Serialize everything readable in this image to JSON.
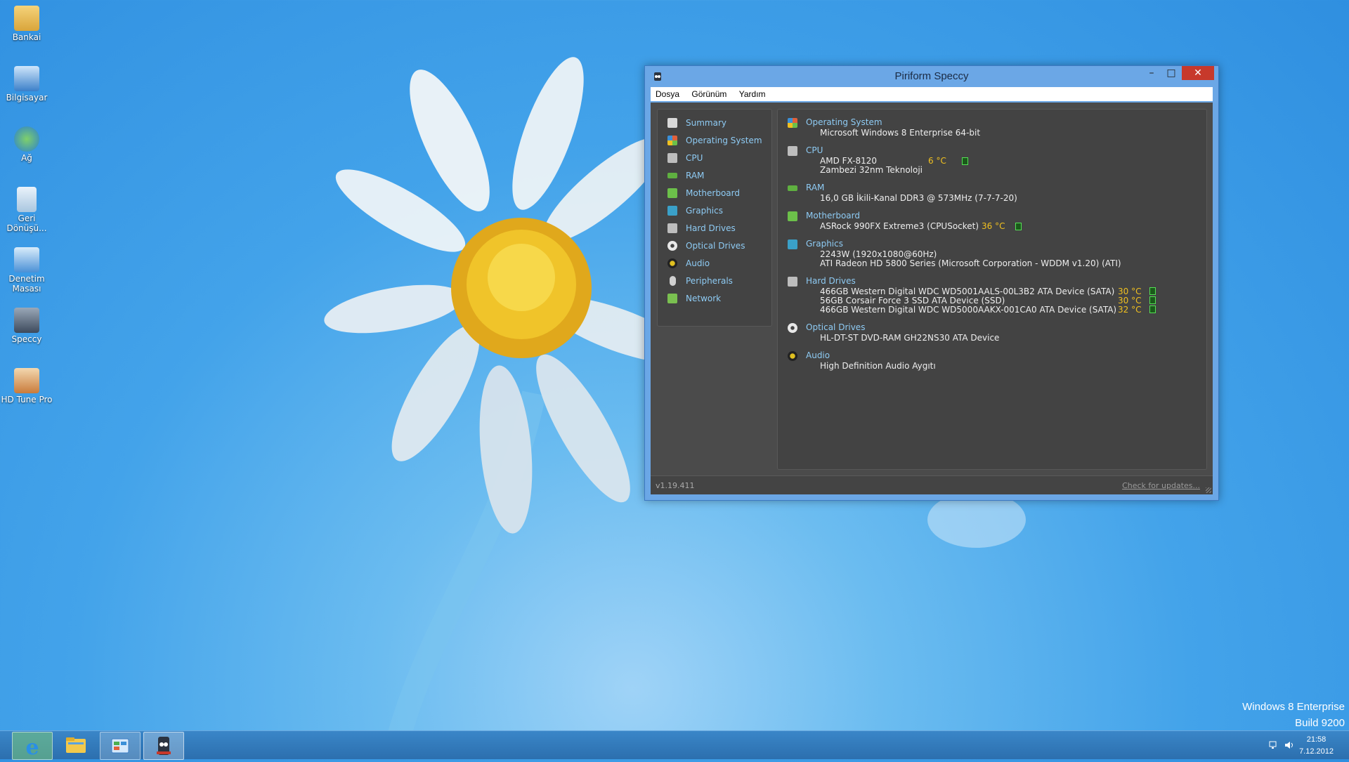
{
  "desktop": {
    "icons": [
      {
        "label": "Bankai",
        "icon": "folder-icon"
      },
      {
        "label": "Bilgisayar",
        "icon": "computer-icon"
      },
      {
        "label": "Ağ",
        "icon": "network-icon"
      },
      {
        "label": "Geri Dönüşü...",
        "icon": "recycle-bin-icon"
      },
      {
        "label": "Denetim Masası",
        "icon": "control-panel-icon"
      },
      {
        "label": "Speccy",
        "icon": "speccy-icon"
      },
      {
        "label": "HD Tune Pro",
        "icon": "hd-tune-icon"
      }
    ],
    "watermark": {
      "line1": "Windows 8 Enterprise",
      "line2": "Build 9200"
    }
  },
  "window": {
    "title": "Piriform Speccy",
    "controls": {
      "minimize": "–",
      "maximize": "□",
      "close": "✕"
    },
    "menu": [
      "Dosya",
      "Görünüm",
      "Yardım"
    ],
    "sidebar": [
      {
        "label": "Summary",
        "icon": "summary-icon",
        "color": "#d8d8d8"
      },
      {
        "label": "Operating System",
        "icon": "windows-icon",
        "color": "#e0603a"
      },
      {
        "label": "CPU",
        "icon": "cpu-icon",
        "color": "#bdbdbd"
      },
      {
        "label": "RAM",
        "icon": "ram-icon",
        "color": "#5fb040"
      },
      {
        "label": "Motherboard",
        "icon": "motherboard-icon",
        "color": "#6cc04a"
      },
      {
        "label": "Graphics",
        "icon": "graphics-icon",
        "color": "#3aa0c8"
      },
      {
        "label": "Hard Drives",
        "icon": "hard-drive-icon",
        "color": "#bdbdbd"
      },
      {
        "label": "Optical Drives",
        "icon": "optical-drive-icon",
        "color": "#e8e8e8"
      },
      {
        "label": "Audio",
        "icon": "audio-icon",
        "color": "#e0c020"
      },
      {
        "label": "Peripherals",
        "icon": "peripherals-icon",
        "color": "#d0d0d0"
      },
      {
        "label": "Network",
        "icon": "network-icon",
        "color": "#7ac050"
      }
    ],
    "summary": {
      "os": {
        "title": "Operating System",
        "value": "Microsoft Windows 8 Enterprise 64-bit"
      },
      "cpu": {
        "title": "CPU",
        "model": "AMD FX-8120",
        "temp": "6 °C",
        "detail": "Zambezi 32nm Teknoloji"
      },
      "ram": {
        "title": "RAM",
        "value": "16,0 GB İkili-Kanal DDR3 @ 573MHz (7-7-7-20)"
      },
      "motherboard": {
        "title": "Motherboard",
        "value": "ASRock 990FX Extreme3 (CPUSocket)",
        "temp": "36 °C"
      },
      "graphics": {
        "title": "Graphics",
        "monitor": "2243W (1920x1080@60Hz)",
        "card": "ATI Radeon HD 5800 Series (Microsoft Corporation - WDDM v1.20) (ATI)"
      },
      "hard_drives": {
        "title": "Hard Drives",
        "items": [
          {
            "name": "466GB Western Digital WDC WD5001AALS-00L3B2 ATA Device (SATA)",
            "temp": "30 °C"
          },
          {
            "name": "56GB Corsair Force 3 SSD ATA Device (SSD)",
            "temp": "30 °C"
          },
          {
            "name": "466GB Western Digital WDC WD5000AAKX-001CA0 ATA Device (SATA)",
            "temp": "32 °C"
          }
        ]
      },
      "optical": {
        "title": "Optical Drives",
        "value": "HL-DT-ST DVD-RAM GH22NS30 ATA Device"
      },
      "audio": {
        "title": "Audio",
        "value": "High Definition Audio Aygıtı"
      }
    },
    "status": {
      "version": "v1.19.411",
      "update_link": "Check for updates..."
    }
  },
  "taskbar": {
    "apps": [
      {
        "name": "Internet Explorer",
        "icon": "internet-explorer-icon"
      },
      {
        "name": "File Explorer",
        "icon": "file-explorer-icon"
      },
      {
        "name": "Control Panel",
        "icon": "control-panel-icon"
      },
      {
        "name": "Speccy",
        "icon": "speccy-icon"
      }
    ],
    "clock": {
      "time": "21:58",
      "date": "7.12.2012"
    }
  }
}
